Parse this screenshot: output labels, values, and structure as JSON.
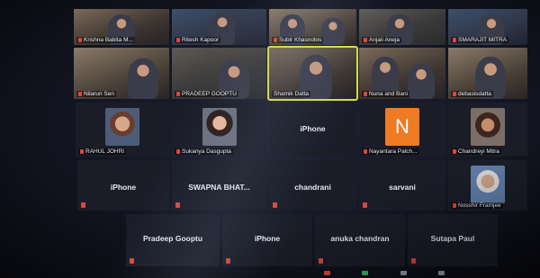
{
  "meeting": {
    "row1": [
      {
        "name": "Krishna Babita M..."
      },
      {
        "name": "Ritesh Kapoor"
      },
      {
        "name": "Subir Khasnobis"
      },
      {
        "name": "Anjali Aneja"
      },
      {
        "name": "SMARAJIT MITRA"
      }
    ],
    "row2": [
      {
        "name": "Nilarun Sen"
      },
      {
        "name": "PRADEEP GOOPTU"
      },
      {
        "name": "Shamik Datta"
      },
      {
        "name": "Nuna and Bani"
      },
      {
        "name": "debasisdatta"
      }
    ],
    "row3": [
      {
        "name": "RAHUL JOHRI"
      },
      {
        "name": "Sukanya Dasgupta"
      },
      {
        "name": "iPhone"
      },
      {
        "name": "Nayantara Palch...",
        "avatar_letter": "N"
      },
      {
        "name": "Chandreyi Mitra"
      }
    ],
    "row4": [
      {
        "name": "iPhone"
      },
      {
        "name": "SWAPNA BHAT..."
      },
      {
        "name": "chandrani"
      },
      {
        "name": "sarvani"
      },
      {
        "name": "Nosshir Framjee"
      }
    ],
    "row5": [
      {
        "name": "Pradeep Gooptu"
      },
      {
        "name": "iPhone"
      },
      {
        "name": "anuka chandran"
      },
      {
        "name": "Sutapa Paul"
      }
    ]
  },
  "colors": {
    "active_speaker_border": "#d8dd4a",
    "muted_mic": "#e0463a",
    "avatar_orange": "#ee7b24"
  }
}
